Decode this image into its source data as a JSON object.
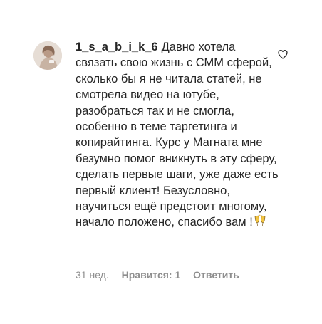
{
  "comment": {
    "username": "1_s_a_b_i_k_6",
    "text": "Давно хотела связать свою жизнь с СММ сферой, сколько бы я не читала статей, не смотрела видео на ютубе, разобраться так и не смогла, особенно в теме таргетинга и копирайтинга. Курс у Магната мне безумно помог вникнуть в эту сферу, сделать первые шаги, уже даже есть первый клиент! Безусловно, научиться ещё предстоит многому, начало положено, спасибо вам !",
    "emoji": "clinking-glasses-emoji",
    "time": "31 нед.",
    "likes": "Нравится: 1",
    "reply": "Ответить"
  },
  "icons": {
    "like": "heart-icon",
    "avatar": "avatar"
  },
  "colors": {
    "text": "#262626",
    "secondary": "#8e8e8e"
  }
}
